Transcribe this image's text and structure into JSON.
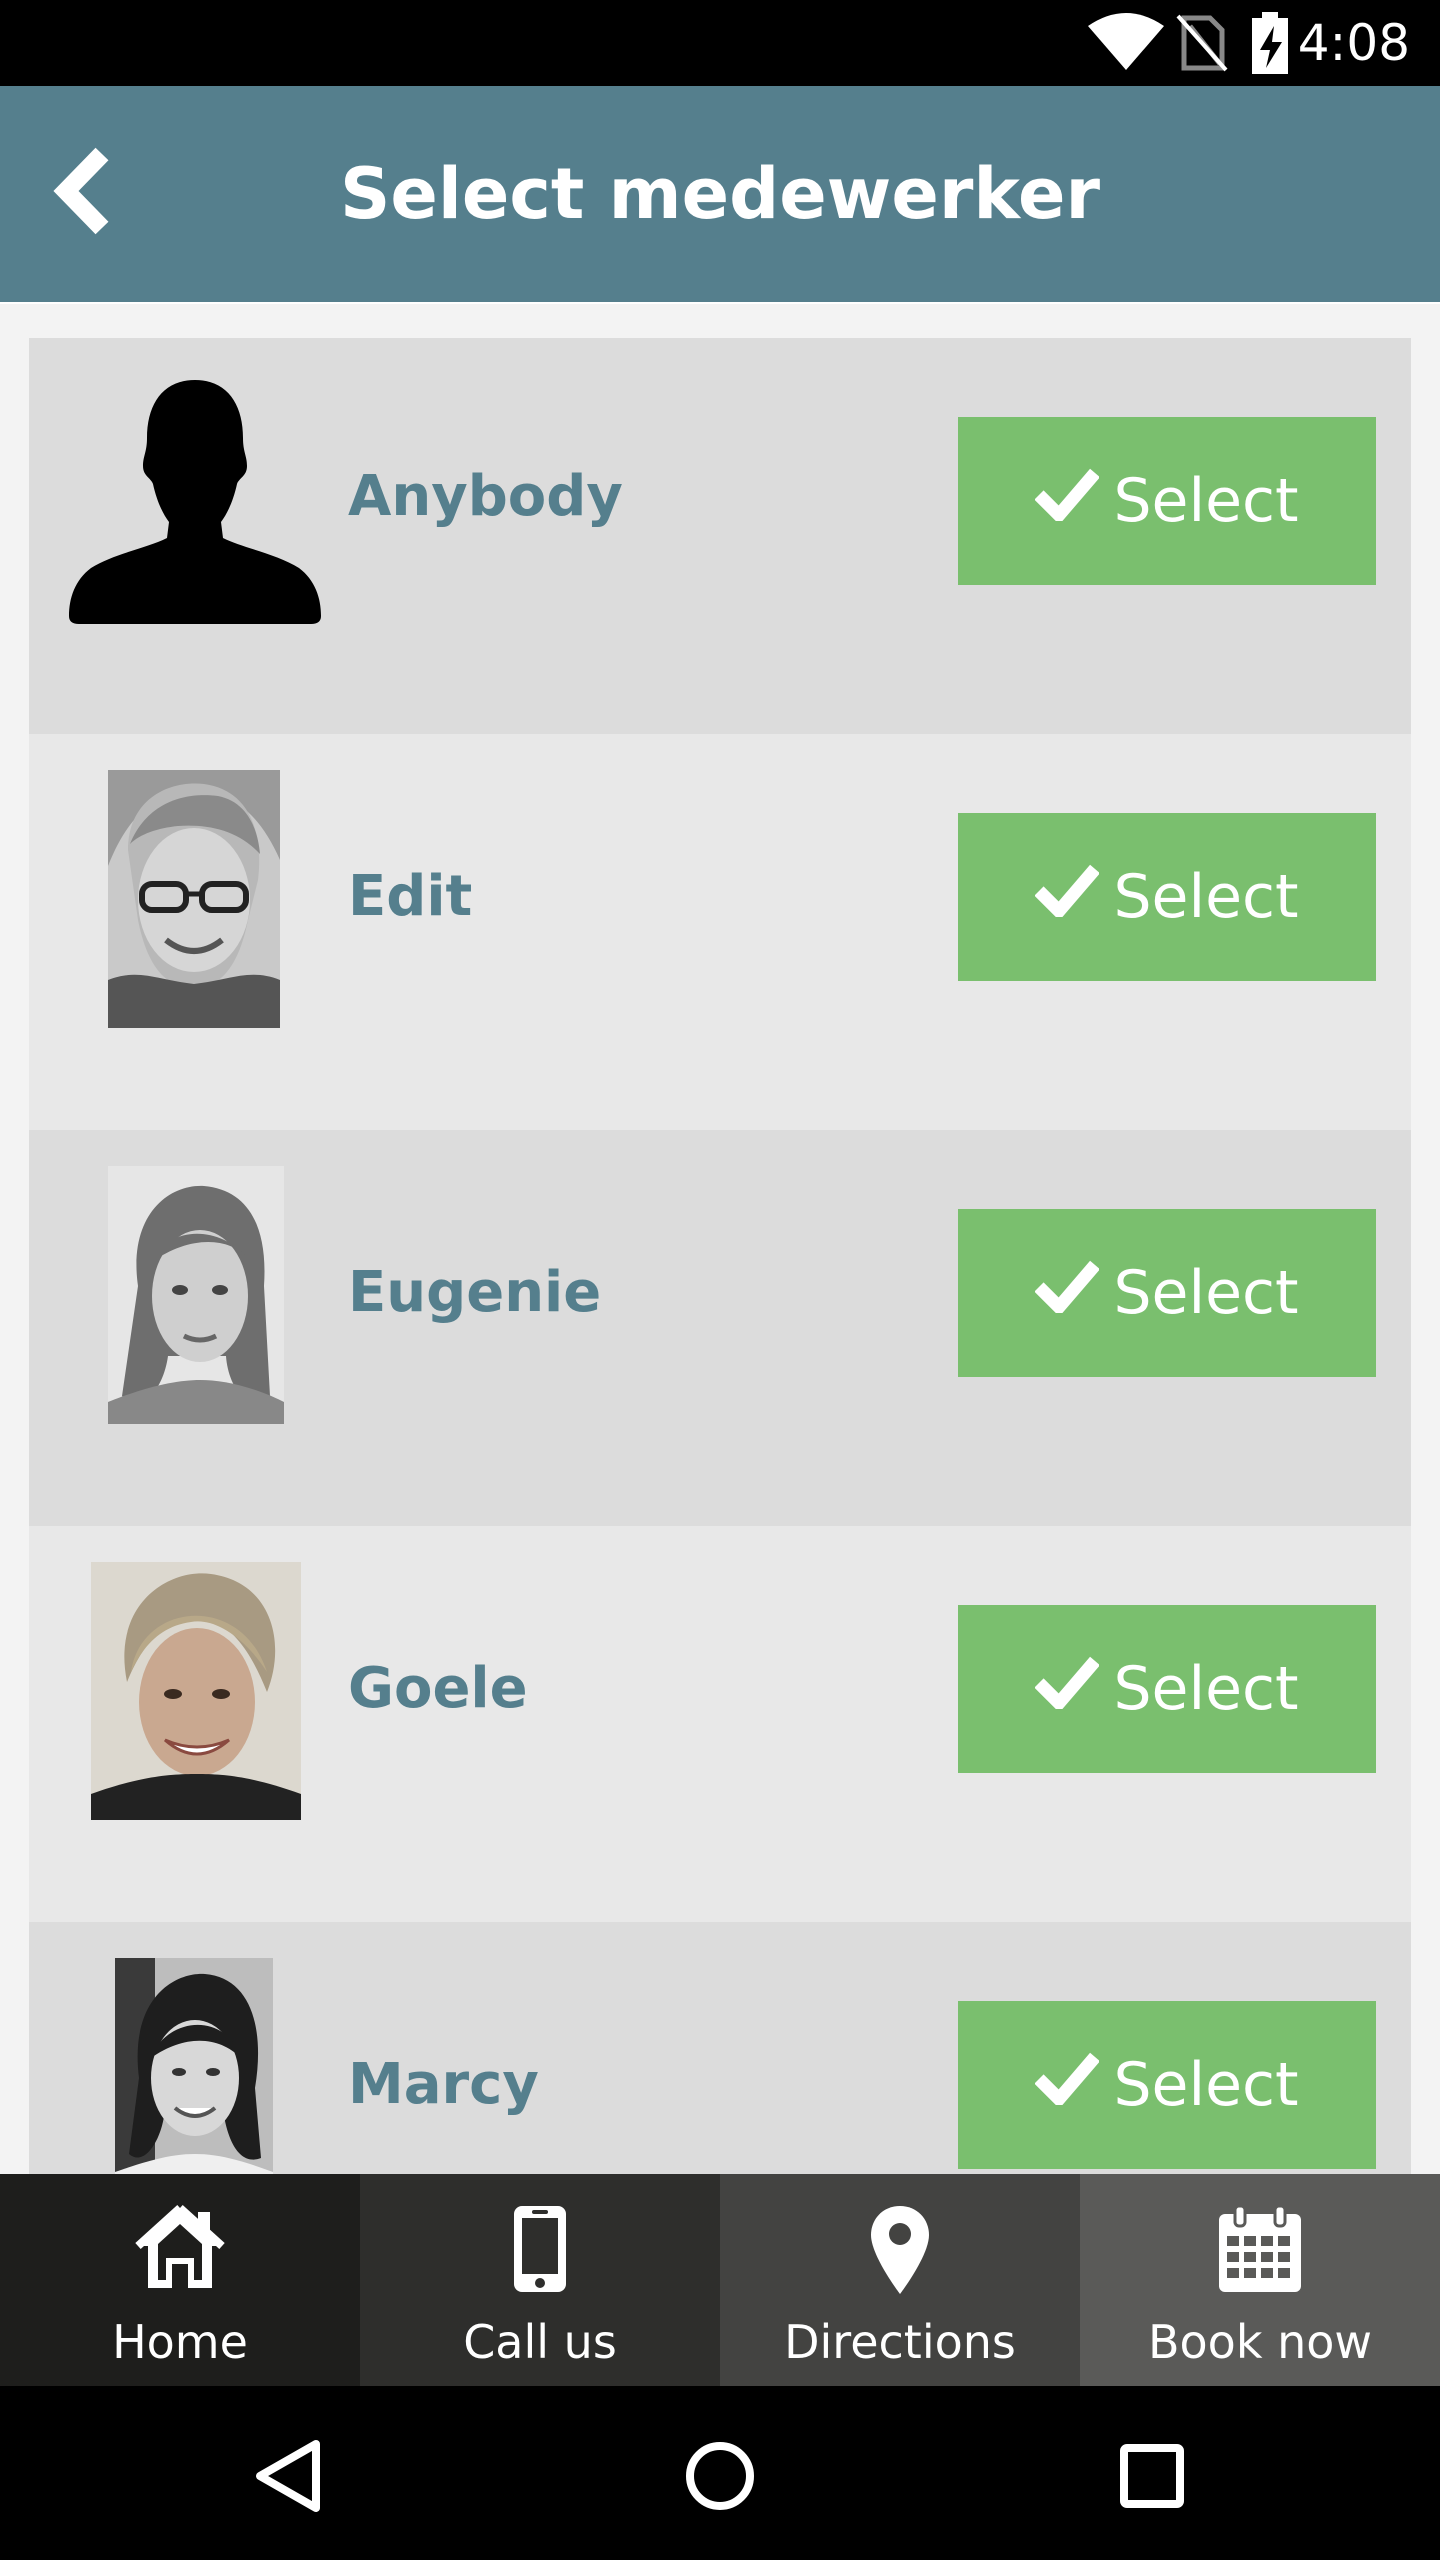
{
  "status_bar": {
    "time": "4:08",
    "icons": [
      "wifi-icon",
      "no-sim-icon",
      "battery-charging-icon"
    ]
  },
  "header": {
    "title": "Select medewerker",
    "back_icon": "chevron-left-icon"
  },
  "employees": [
    {
      "name": "Anybody",
      "avatar": "person-silhouette",
      "button_label": "Select",
      "button_icon": "checkmark-icon"
    },
    {
      "name": "Edit",
      "avatar": "photo",
      "button_label": "Select",
      "button_icon": "checkmark-icon"
    },
    {
      "name": "Eugenie",
      "avatar": "photo",
      "button_label": "Select",
      "button_icon": "checkmark-icon"
    },
    {
      "name": "Goele",
      "avatar": "photo",
      "button_label": "Select",
      "button_icon": "checkmark-icon"
    },
    {
      "name": "Marcy",
      "avatar": "photo",
      "button_label": "Select",
      "button_icon": "checkmark-icon"
    }
  ],
  "bottom_nav": [
    {
      "label": "Home",
      "icon": "home-icon",
      "bg": "#1e1e1c"
    },
    {
      "label": "Call us",
      "icon": "phone-icon",
      "bg": "#2e2e2c"
    },
    {
      "label": "Directions",
      "icon": "map-pin-icon",
      "bg": "#434341"
    },
    {
      "label": "Book now",
      "icon": "calendar-icon",
      "bg": "#5a5a58"
    }
  ],
  "system_nav": {
    "icons": [
      "back-triangle-icon",
      "home-circle-icon",
      "recents-square-icon"
    ]
  },
  "colors": {
    "header": "#557f8d",
    "name_text": "#557f8d",
    "select_button": "#7abf6e",
    "row_dark": "#dcdcdc",
    "row_light": "#e8e8e8"
  }
}
